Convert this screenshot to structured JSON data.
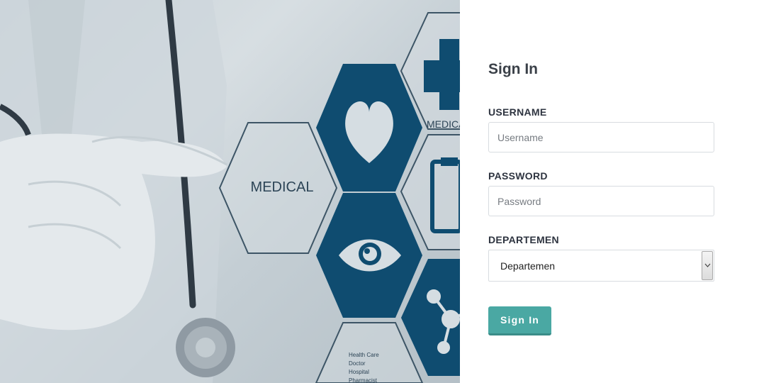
{
  "hero": {
    "hex_labels": {
      "medical_main": "MEDICAL",
      "medical_partial": "MEDICA",
      "small_lines": [
        "Health Care",
        "Doctor",
        "Hospital",
        "Pharmacist"
      ]
    }
  },
  "form": {
    "title": "Sign In",
    "username": {
      "label": "USERNAME",
      "placeholder": "Username"
    },
    "password": {
      "label": "PASSWORD",
      "placeholder": "Password"
    },
    "department": {
      "label": "DEPARTEMEN",
      "selected": "Departemen"
    },
    "submit_label": "Sign In"
  },
  "colors": {
    "accent": "#4aa8a3",
    "hex_dark": "#0f4c70",
    "title_text": "#3a4048"
  }
}
